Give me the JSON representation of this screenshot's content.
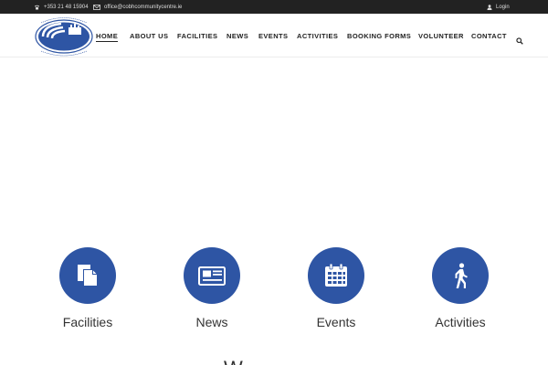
{
  "topbar": {
    "phone": "+353 21 48 15904",
    "email": "office@cobhcommunitycentre.ie",
    "login": "Login"
  },
  "logo": {
    "name": "Cobh Great Island Community Centre",
    "colors": {
      "ring": "#2e55a4",
      "text": "#2e55a4"
    }
  },
  "nav": {
    "items": [
      {
        "label": "HOME",
        "active": true
      },
      {
        "label": "ABOUT US",
        "active": false
      },
      {
        "label": "FACILITIES",
        "active": false
      },
      {
        "label": "NEWS",
        "active": false
      },
      {
        "label": "EVENTS",
        "active": false
      },
      {
        "label": "ACTIVITIES",
        "active": false
      },
      {
        "label": "BOOKING FORMS",
        "active": false
      },
      {
        "label": "VOLUNTEER",
        "active": false
      },
      {
        "label": "CONTACT",
        "active": false
      }
    ],
    "search_icon": "search-icon"
  },
  "features": [
    {
      "label": "Facilities",
      "icon": "documents-icon"
    },
    {
      "label": "News",
      "icon": "newspaper-icon"
    },
    {
      "label": "Events",
      "icon": "calendar-icon"
    },
    {
      "label": "Activities",
      "icon": "walking-person-icon"
    }
  ],
  "colors": {
    "topbar_bg": "#222222",
    "accent": "#2e55a4",
    "text": "#333333"
  }
}
